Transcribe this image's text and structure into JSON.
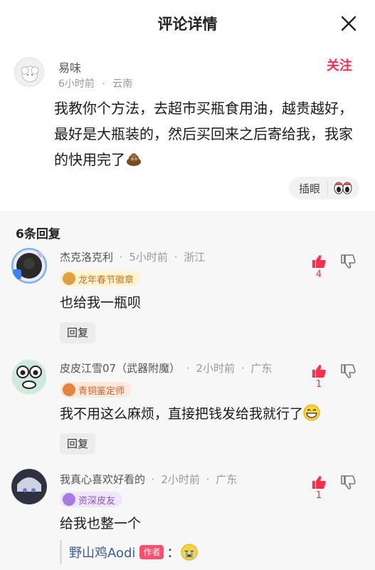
{
  "header": {
    "title": "评论详情",
    "close_icon": "close-icon"
  },
  "main_comment": {
    "user": "易味",
    "time": "6小时前",
    "location": "云南",
    "follow_label": "关注",
    "text": "我教你个方法，去超市买瓶食用油，越贵越好，最好是大瓶装的，然后买回来之后寄给我，我家的快用完了",
    "reaction_label": "插眼",
    "accent": "#ff2e4d"
  },
  "replies": {
    "count_label": "6条回复",
    "items": [
      {
        "user": "杰克洛克利",
        "time": "5小时前",
        "location": "浙江",
        "badge": "龙年春节徽章",
        "text": "也给我一瓶呗",
        "reply_label": "回复",
        "likes": "4"
      },
      {
        "user": "皮皮江雪07（武器附魔）",
        "time": "2小时前",
        "location": "广东",
        "badge": "青铜鉴定师",
        "text": "我不用这么麻烦，直接把钱发给我就行了",
        "reply_label": "回复",
        "likes": "1"
      },
      {
        "user": "我真心喜欢好看的",
        "time": "2小时前",
        "location": "广东",
        "badge": "资深皮友",
        "text": "给我也整一个",
        "likes": "1",
        "nested": {
          "user": "野山鸡Aodi",
          "tag": "作者",
          "colon": "："
        }
      }
    ]
  },
  "separator": "·"
}
